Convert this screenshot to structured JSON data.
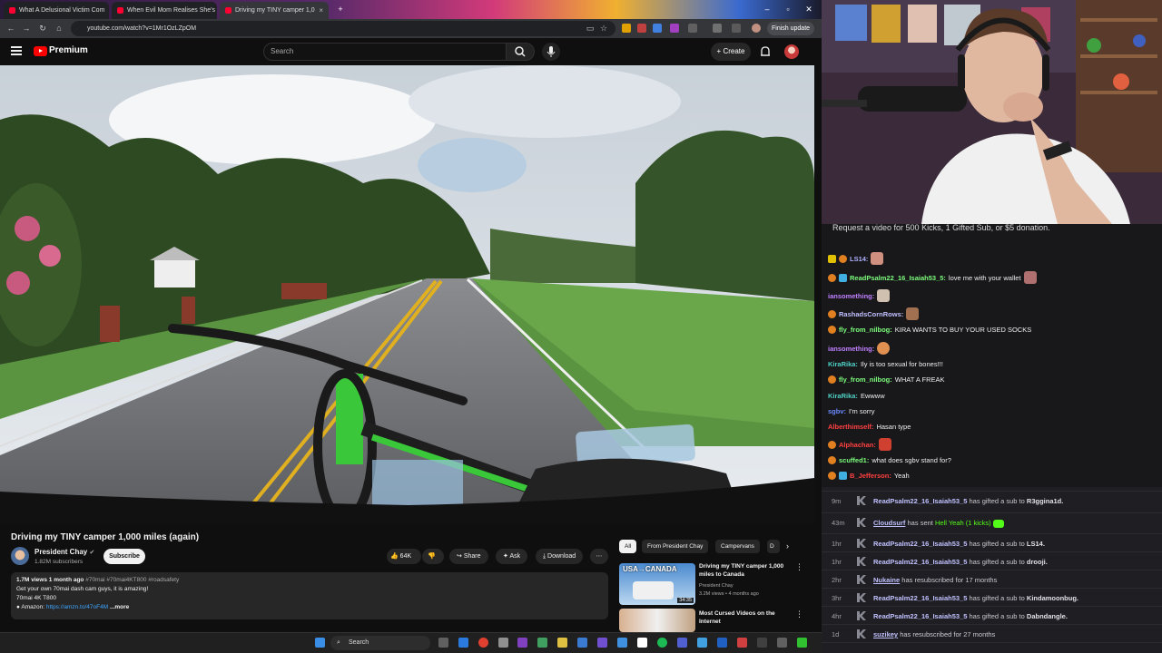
{
  "browser": {
    "tabs": [
      {
        "title": "What A Delusional Victim Com"
      },
      {
        "title": "When Evil Mom Realises She's"
      },
      {
        "title": "Driving my TINY camper 1,0"
      }
    ],
    "url": "youtube.com/watch?v=1Mr1OzLZpOM",
    "finish_update": "Finish update"
  },
  "youtube": {
    "logo_text": "Premium",
    "search_placeholder": "Search",
    "create_label": "Create",
    "video": {
      "title": "Driving my TINY camper 1,000 miles (again)",
      "channel": "President Chay",
      "subscribers": "1.82M subscribers",
      "subscribe_label": "Subscribe",
      "likes": "64K",
      "share_label": "Share",
      "ask_label": "Ask",
      "download_label": "Download",
      "views_line": "1.7M views  1 month ago",
      "hashtags": "#70mai #70mai4KT800 #roadsafety",
      "desc_line1": "Get your own 70mai dash cam guys, it is amazing!",
      "desc_line2": "70mai 4K T800",
      "amazon_label": "● Amazon: ",
      "amazon_link": "https://amzn.to/47oF4M",
      "more_label": "...more"
    },
    "chips": [
      "All",
      "From President Chay",
      "Campervans",
      "D"
    ],
    "recommendations": [
      {
        "title": "Driving my TINY camper 1,000 miles to Canada",
        "channel": "President Chay",
        "meta": "3.2M views • 4 months ago",
        "duration": "34:35",
        "thumb_text": "USA→CANADA"
      },
      {
        "title": "Most Cursed Videos on the Internet",
        "channel": "",
        "meta": "",
        "duration": "",
        "thumb_text": ""
      }
    ]
  },
  "taskbar": {
    "search_label": "Search"
  },
  "chat": {
    "header": "Request a video for 500 Kicks, 1 Gifted Sub, or $5 donation.",
    "messages": [
      {
        "user": "LS14:",
        "text": "",
        "color": "#b0b0ff"
      },
      {
        "user": "ReadPsalm22_16_Isaiah53_5:",
        "text": "love me with your wallet",
        "color": "#7cfc7c"
      },
      {
        "user": "iansomething:",
        "text": "",
        "color": "#c080ff"
      },
      {
        "user": "RashadsCornRows:",
        "text": "",
        "color": "#c0c0ff"
      },
      {
        "user": "fly_from_nilbog:",
        "text": "KIRA WANTS TO BUY YOUR USED SOCKS",
        "color": "#7cfc7c"
      },
      {
        "user": "iansomething:",
        "text": "",
        "color": "#c080ff"
      },
      {
        "user": "KiraRika:",
        "text": "Ily is too sexual for bones!!!",
        "color": "#4fd1c5"
      },
      {
        "user": "fly_from_nilbog:",
        "text": "WHAT A FREAK",
        "color": "#7cfc7c"
      },
      {
        "user": "KiraRika:",
        "text": "Ewwww",
        "color": "#4fd1c5"
      },
      {
        "user": "sgbv:",
        "text": "I'm sorry",
        "color": "#6a8aff"
      },
      {
        "user": "Alberthimself:",
        "text": "Hasan type",
        "color": "#ff4040"
      },
      {
        "user": "Alphachan:",
        "text": "",
        "color": "#ff4040"
      },
      {
        "user": "scuffed1:",
        "text": "what does sgbv stand for?",
        "color": "#7cfc7c"
      },
      {
        "user": "B_Jefferson:",
        "text": "Yeah",
        "color": "#ff4040"
      }
    ]
  },
  "events": [
    {
      "time": "9m",
      "user": "ReadPsalm22_16_Isaiah53_5",
      "action": "has gifted a sub to",
      "target": "R3ggina1d."
    },
    {
      "time": "43m",
      "user": "Cloudsurf",
      "action": "has sent",
      "target": "Hell Yeah (1 kicks)"
    },
    {
      "time": "1hr",
      "user": "ReadPsalm22_16_Isaiah53_5",
      "action": "has gifted a sub to",
      "target": "LS14."
    },
    {
      "time": "1hr",
      "user": "ReadPsalm22_16_Isaiah53_5",
      "action": "has gifted a sub to",
      "target": "drooji."
    },
    {
      "time": "2hr",
      "user": "Nukaine",
      "action": "has resubscribed for 17 months",
      "target": ""
    },
    {
      "time": "3hr",
      "user": "ReadPsalm22_16_Isaiah53_5",
      "action": "has gifted a sub to",
      "target": "Kindamoonbug."
    },
    {
      "time": "4hr",
      "user": "ReadPsalm22_16_Isaiah53_5",
      "action": "has gifted a sub to",
      "target": "Dabndangle."
    },
    {
      "time": "1d",
      "user": "suzikey",
      "action": "has resubscribed for 27 months",
      "target": ""
    }
  ],
  "colors": {
    "yt_red": "#ff0000",
    "chat_bg": "#18181b",
    "kick_green": "#53fc18"
  }
}
